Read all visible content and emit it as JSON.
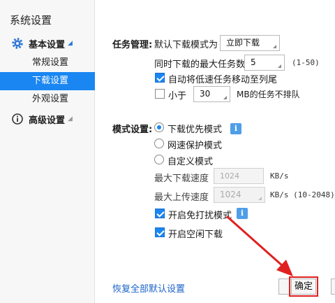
{
  "sidebar": {
    "title": "系统设置",
    "groups": [
      {
        "label": "基本设置",
        "icon": "gear-icon",
        "expanded": true
      },
      {
        "label": "高级设置",
        "icon": "info-circle-icon",
        "expanded": false
      }
    ],
    "items": [
      {
        "label": "常规设置",
        "active": false
      },
      {
        "label": "下载设置",
        "active": true
      },
      {
        "label": "外观设置",
        "active": false
      }
    ]
  },
  "task": {
    "section_label": "任务管理:",
    "default_mode_label": "默认下载模式为",
    "default_mode_value": "立即下载",
    "max_tasks_label": "同时下载的最大任务数",
    "max_tasks_value": "5",
    "max_tasks_range": "(1-50)",
    "auto_move_label": "自动将低速任务移动至列尾",
    "less_than_label": "小于",
    "less_than_value": "30",
    "less_than_suffix": "MB的任务不排队"
  },
  "mode": {
    "section_label": "模式设置:",
    "options": [
      "下载优先模式",
      "网速保护模式",
      "自定义模式"
    ],
    "selected": "下载优先模式",
    "max_download_label": "最大下载速度",
    "max_download_value": "1024",
    "max_download_unit": "KB/s",
    "max_upload_label": "最大上传速度",
    "max_upload_value": "1024",
    "max_upload_unit": "KB/s (10-2048)",
    "no_disturb_label": "开启免打扰模式",
    "idle_download_label": "开启空闲下载"
  },
  "footer": {
    "restore_label": "恢复全部默认设置",
    "ok_label": "确定"
  },
  "colors": {
    "accent": "#1a86f2",
    "link": "#1a63c8",
    "annotation_red": "#e02020"
  }
}
